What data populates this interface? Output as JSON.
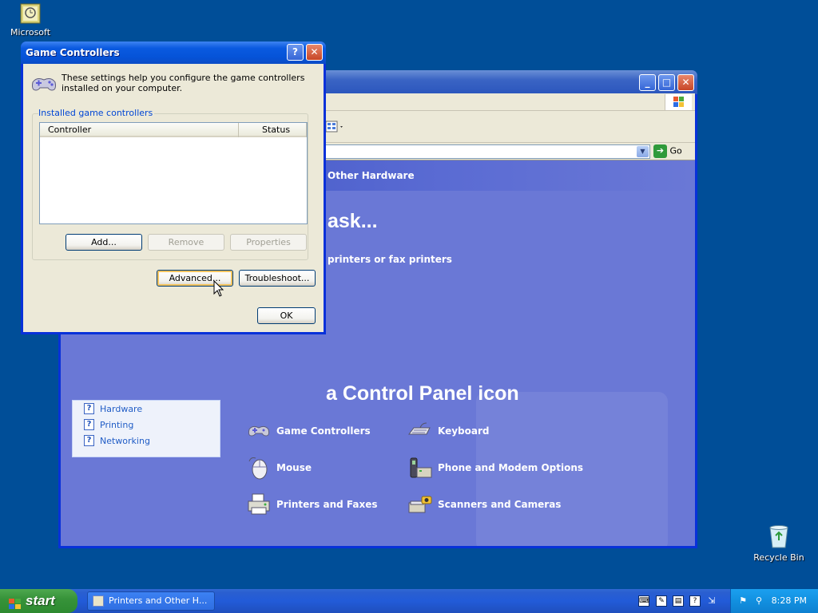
{
  "desktop": {
    "icons": [
      {
        "label": "Microsoft",
        "icon": "outlook-icon"
      },
      {
        "label": "Recycle Bin",
        "icon": "recycle-bin-icon"
      }
    ]
  },
  "explorer": {
    "header_title": "Other Hardware",
    "task_heading": "ask...",
    "task_link": "printers or fax printers",
    "icon_heading": "a Control Panel icon",
    "go_label": "Go",
    "see_also": [
      {
        "label": "Hardware"
      },
      {
        "label": "Printing"
      },
      {
        "label": "Networking"
      }
    ],
    "items": [
      {
        "label": "Game Controllers",
        "icon": "gamepad-icon"
      },
      {
        "label": "Keyboard",
        "icon": "keyboard-icon"
      },
      {
        "label": "Mouse",
        "icon": "mouse-icon"
      },
      {
        "label": "Phone and Modem Options",
        "icon": "phone-modem-icon"
      },
      {
        "label": "Printers and Faxes",
        "icon": "printer-icon"
      },
      {
        "label": "Scanners and Cameras",
        "icon": "scanner-icon"
      }
    ]
  },
  "dialog": {
    "title": "Game Controllers",
    "intro": "These settings help you configure the game controllers installed on your computer.",
    "group_label": "Installed game controllers",
    "columns": [
      "Controller",
      "Status"
    ],
    "rows": [],
    "buttons": {
      "add": "Add...",
      "remove": "Remove",
      "properties": "Properties",
      "advanced": "Advanced...",
      "troubleshoot": "Troubleshoot...",
      "ok": "OK"
    }
  },
  "taskbar": {
    "start_label": "start",
    "task_button": "Printers and Other H...",
    "clock": "8:28 PM"
  },
  "colors": {
    "desktop": "#004e98",
    "content_bg": "#6a78d6",
    "dialog_face": "#ece9d8",
    "link_blue": "#215dc6"
  }
}
